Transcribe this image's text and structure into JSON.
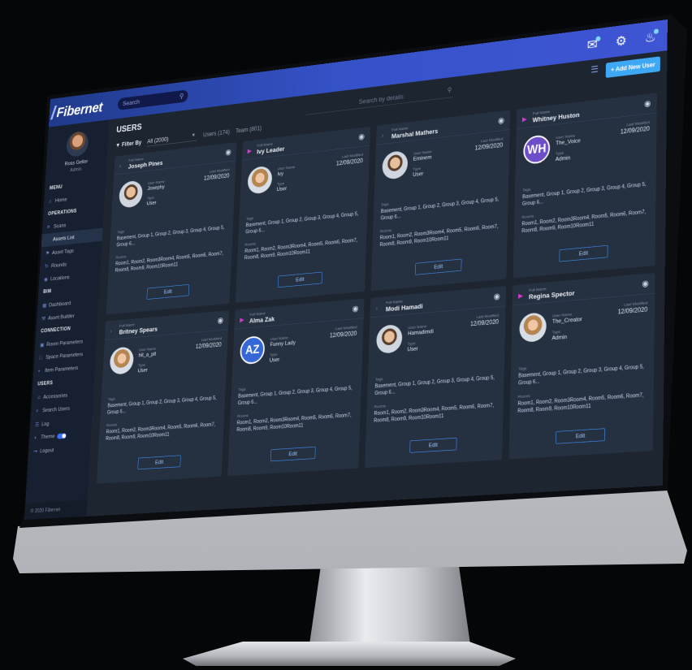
{
  "app": {
    "brand": "Fibernet",
    "search_placeholder": "Search",
    "icons": {
      "messages": "chat-icon",
      "settings": "gear-icon",
      "notifications": "bell-icon"
    }
  },
  "sidebar": {
    "user_name": "Ross Geller",
    "user_role": "Admin",
    "items": [
      {
        "label": "MENU",
        "section": true
      },
      {
        "label": "Home",
        "icon": "home-icon"
      },
      {
        "label": "OPERATIONS",
        "section": true
      },
      {
        "label": "Scans",
        "icon": "scan-icon"
      },
      {
        "label": "Assets List",
        "icon": "",
        "active": true
      },
      {
        "label": "Asset Tags",
        "icon": "tag-icon"
      },
      {
        "label": "Rounds",
        "icon": "rounds-icon"
      },
      {
        "label": "Locations",
        "icon": "pin-icon"
      },
      {
        "label": "BIM",
        "section": true
      },
      {
        "label": "Dashboard",
        "icon": "dashboard-icon"
      },
      {
        "label": "Asset Builder",
        "icon": "wrench-icon"
      },
      {
        "label": "CONNECTION",
        "section": true
      },
      {
        "label": "Room Parameters",
        "icon": "room-icon"
      },
      {
        "label": "Space Parameters",
        "icon": "space-icon"
      },
      {
        "label": "Item Parameters",
        "icon": "item-icon"
      },
      {
        "label": "USERS",
        "section": true
      },
      {
        "label": "Accessories",
        "icon": "users-icon"
      },
      {
        "label": "Search Users",
        "icon": "search-icon"
      },
      {
        "label": "Log",
        "icon": "log-icon"
      },
      {
        "label": "Theme",
        "icon": "theme-icon",
        "toggle": true
      },
      {
        "label": "Logout",
        "icon": "logout-icon"
      }
    ],
    "footer": "© 2020 Fibernet"
  },
  "main": {
    "title": "USERS",
    "search_placeholder": "Search by details",
    "add_button": "+ Add New User",
    "filter": {
      "label": "Filter By",
      "selected": "All (2000)",
      "counts": [
        "Users (174)",
        "Team (801)"
      ]
    },
    "view_icons": [
      "list-view-icon",
      "grid-view-icon"
    ]
  },
  "labels": {
    "username": "User Name",
    "type": "Type",
    "modified": "Last Modified",
    "tags": "Tags",
    "rooms": "Rooms",
    "edit": "Edit"
  },
  "cards": [
    {
      "role": "Full Name",
      "name": "Joseph Pines",
      "chevron": "grey",
      "avatar": "photo",
      "username": "Josephy",
      "type": "User",
      "modified": "12/09/2020",
      "tags": "Basement, Group 1, Group 2, Group 3, Group 4, Group 5, Group 6...",
      "rooms": "Room1, Room2, Room3Room4, Room5, Room6, Room7, Room8, Room9, Room10Room11"
    },
    {
      "role": "Full Name",
      "name": "Ivy Leader",
      "chevron": "pink",
      "avatar": "photo-f",
      "username": "Ivy",
      "type": "User",
      "modified": "12/09/2020",
      "tags": "Basement, Group 1, Group 2, Group 3, Group 4, Group 5, Group 6...",
      "rooms": "Room1, Room2, Room3Room4, Room5, Room6, Room7, Room8, Room9, Room10Room11"
    },
    {
      "role": "Full Name",
      "name": "Marshal Mathers",
      "chevron": "grey",
      "avatar": "photo",
      "username": "Eminem",
      "type": "User",
      "modified": "12/09/2020",
      "tags": "Basement, Group 1, Group 2, Group 3, Group 4, Group 5, Group 6...",
      "rooms": "Room1, Room2, Room3Room4, Room5, Room6, Room7, Room8, Room9, Room10Room11"
    },
    {
      "role": "Full Name",
      "name": "Whitney Huston",
      "chevron": "pink",
      "avatar": "initials",
      "initials": "WH",
      "username": "The_Voice",
      "type": "Admin",
      "modified": "12/09/2020",
      "tags": "Basement, Group 1, Group 2, Group 3, Group 4, Group 5, Group 6...",
      "rooms": "Room1, Room2, Room3Room4, Room5, Room6, Room7, Room8, Room9, Room10Room11"
    },
    {
      "role": "Full Name",
      "name": "Britney Spears",
      "chevron": "grey",
      "avatar": "photo-f",
      "username": "hit_a_pll",
      "type": "User",
      "modified": "12/09/2020",
      "tags": "Basement, Group 1, Group 2, Group 3, Group 4, Group 5, Group 6...",
      "rooms": "Room1, Room2, Room3Room4, Room5, Room6, Room7, Room8, Room9, Room10Room11"
    },
    {
      "role": "Full Name",
      "name": "Alma Zak",
      "chevron": "pink",
      "avatar": "initials-blue",
      "initials": "AZ",
      "username": "Funny Lady",
      "type": "User",
      "modified": "12/09/2020",
      "tags": "Basement, Group 1, Group 2, Group 3, Group 4, Group 5, Group 6...",
      "rooms": "Room1, Room2, Room3Room4, Room5, Room6, Room7, Room8, Room9, Room10Room11"
    },
    {
      "role": "Full Name",
      "name": "Modi Hamadi",
      "chevron": "grey",
      "avatar": "photo",
      "username": "Hamadimdi",
      "type": "User",
      "modified": "12/09/2020",
      "tags": "Basement, Group 1, Group 2, Group 3, Group 4, Group 5, Group 6...",
      "rooms": "Room1, Room2, Room3Room4, Room5, Room6, Room7, Room8, Room9, Room10Room11"
    },
    {
      "role": "Full Name",
      "name": "Regina Spector",
      "chevron": "pink",
      "avatar": "photo-f",
      "username": "The_Creator",
      "type": "Admin",
      "modified": "12/09/2020",
      "tags": "Basement, Group 1, Group 2, Group 3, Group 4, Group 5, Group 6...",
      "rooms": "Room1, Room2, Room3Room4, Room5, Room6, Room7, Room8, Room9, Room10Room11"
    }
  ]
}
